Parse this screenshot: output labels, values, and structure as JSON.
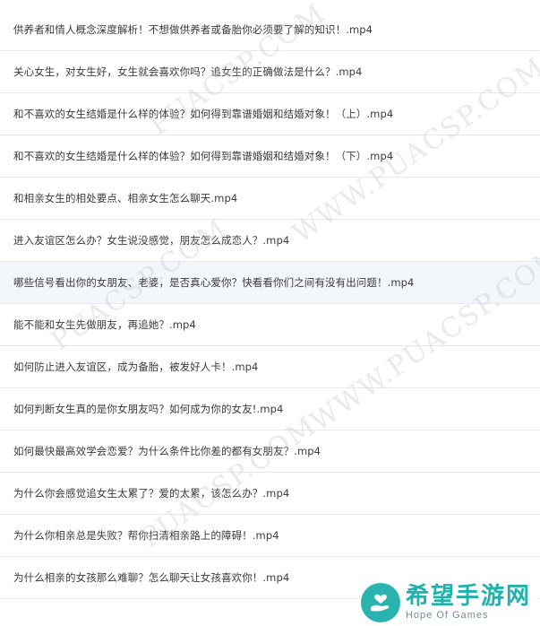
{
  "files": [
    "供养者和情人概念深度解析！不想做供养者或备胎你必须要了解的知识！.mp4",
    "关心女生，对女生好，女生就会喜欢你吗？追女生的正确做法是什么？.mp4",
    "和不喜欢的女生结婚是什么样的体验？如何得到靠谱婚姻和结婚对象！（上）.mp4",
    "和不喜欢的女生结婚是什么样的体验？如何得到靠谱婚姻和结婚对象！（下）.mp4",
    "和相亲女生的相处要点、相亲女生怎么聊天.mp4",
    "进入友谊区怎么办？女生说没感觉，朋友怎么成恋人？.mp4",
    "哪些信号看出你的女朋友、老婆，是否真心爱你？快看看你们之间有没有出问题！.mp4",
    "能不能和女生先做朋友，再追她？.mp4",
    "如何防止进入友谊区，成为备胎，被发好人卡！.mp4",
    "如何判断女生真的是你女朋友吗？如何成为你的女友!.mp4",
    "如何最快最高效学会恋爱？为什么条件比你差的都有女朋友？.mp4",
    "为什么你会感觉追女生太累了？爱的太累，该怎么办？.mp4",
    "为什么你相亲总是失败？帮你扫清相亲路上的障碍！.mp4",
    "为什么相亲的女孩那么难聊？怎么聊天让女孩喜欢你！.mp4"
  ],
  "watermark": {
    "text_a": "PUACSP.COM",
    "text_b": "WWW.PUACSP.COM"
  },
  "brand": {
    "name_cn": "希望手游网",
    "name_en": "Hope Of Games",
    "color": "#22b0ac"
  }
}
